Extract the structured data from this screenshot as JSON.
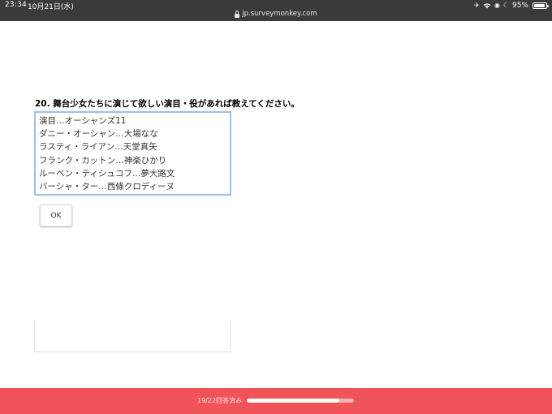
{
  "status_bar": {
    "time": "23:34",
    "date": "10月21日(水)",
    "battery": "95%",
    "icons": [
      "airplane-icon",
      "wifi-icon",
      "location-icon",
      "moon-icon",
      "battery-icon"
    ]
  },
  "browser": {
    "url": "jp.surveymonkey.com"
  },
  "question": {
    "number_and_text": "20. 舞台少女たちに演じて欲しい演目・役があれば教えてください。",
    "answer_lines": [
      "演目…オーシャンズ11",
      "ダニー・オーシャン…大場なな",
      "ラスティ・ライアン…天堂真矢",
      "フランク・カットン…神楽ひかり",
      "ルーベン・ティシュコフ…夢大路文",
      "バーシャ・ター…西條クロディーヌ"
    ],
    "ok_label": "OK"
  },
  "progress": {
    "label": "19/22回答済み",
    "fraction": 0.86
  },
  "colors": {
    "status_bar": "#3a3a3c",
    "footer": "#f05358",
    "textarea_border": "#9fc0e3"
  }
}
